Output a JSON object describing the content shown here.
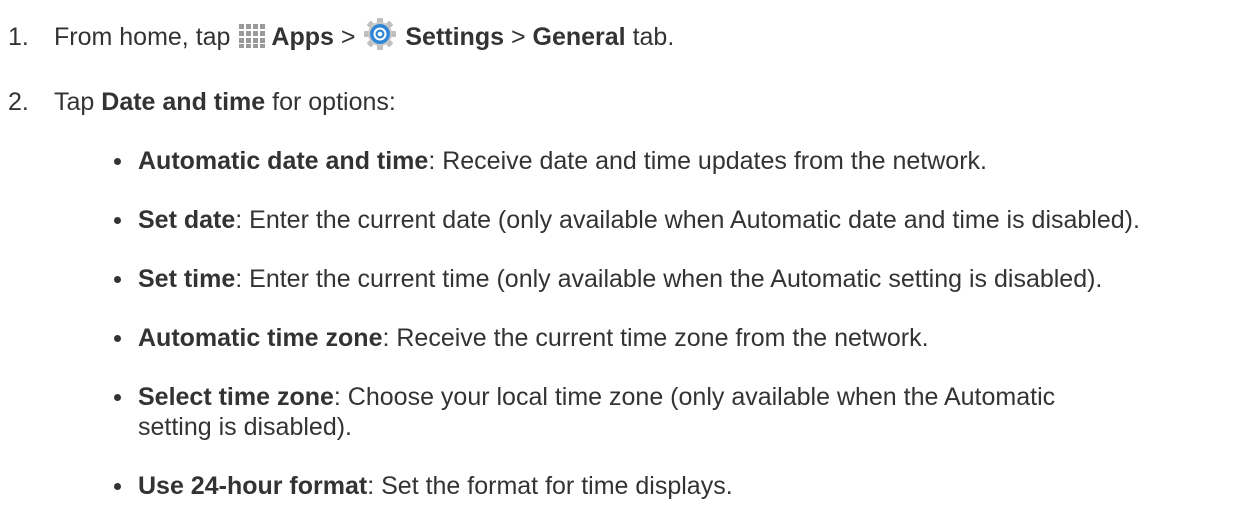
{
  "steps": [
    {
      "number": "1.",
      "prefix": "From home, tap",
      "apps_label": "Apps",
      "sep1": ">",
      "settings_label": "Settings",
      "sep2": ">",
      "general_label": "General",
      "suffix": "tab."
    },
    {
      "number": "2.",
      "prefix": "Tap",
      "bold": "Date and time",
      "suffix": "for options:"
    }
  ],
  "options": [
    {
      "term": "Automatic date and time",
      "desc": ": Receive date and time updates from the network."
    },
    {
      "term": "Set date",
      "desc": ": Enter the current date (only available when Automatic date and time is disabled)."
    },
    {
      "term": "Set time",
      "desc": ": Enter the current time (only available when the Automatic setting is disabled)."
    },
    {
      "term": "Automatic time zone",
      "desc": ": Receive the current time zone from the network."
    },
    {
      "term": "Select time zone",
      "desc": ": Choose your local time zone (only available when the Automatic setting is disabled)."
    },
    {
      "term": "Use 24-hour format",
      "desc": ": Set the format for time displays."
    }
  ],
  "icons": {
    "apps": "apps-grid-icon",
    "settings": "settings-gear-icon"
  },
  "colors": {
    "text": "#333333",
    "apps_icon": "#9a9a9a",
    "settings_icon": "#2f86d6"
  }
}
